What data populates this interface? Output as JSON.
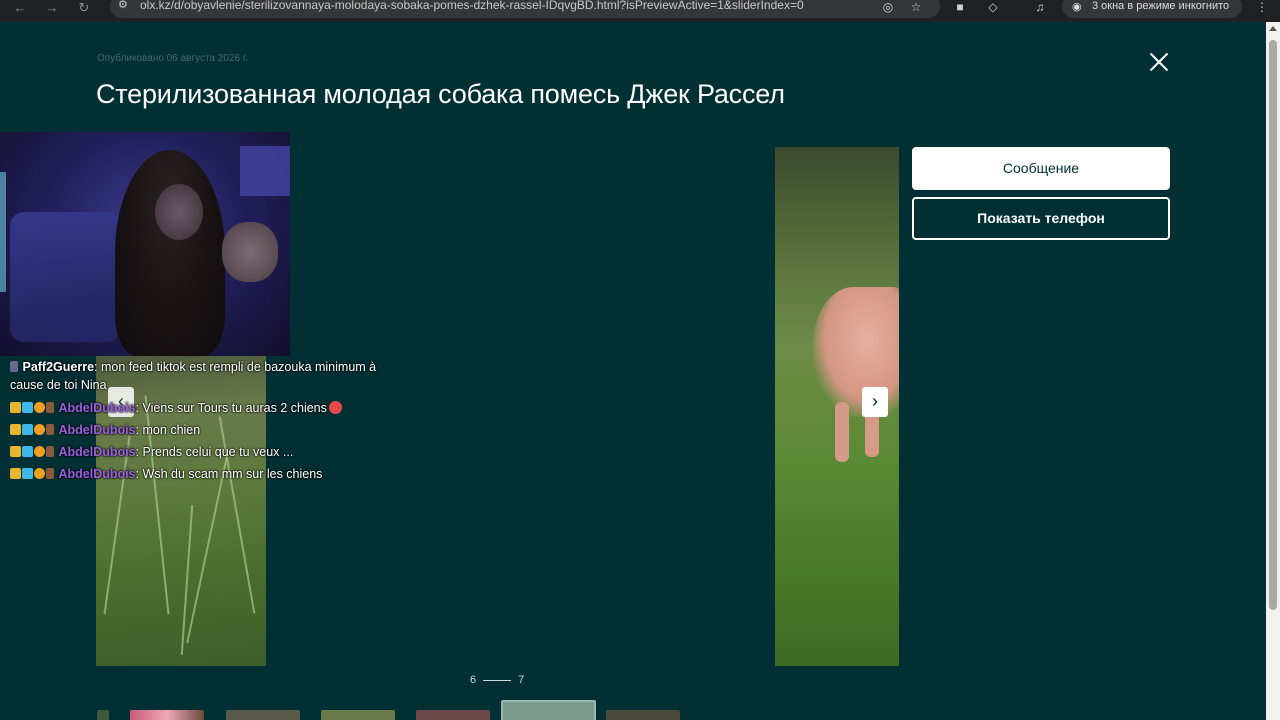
{
  "browser": {
    "url": "olx.kz/d/obyavlenie/sterilizovannaya-molodaya-sobaka-pomes-dzhek-rassel-IDqvgBD.html?isPreviewActive=1&sliderIndex=0",
    "incognito_label": "3 окна в режиме инкогнито"
  },
  "listing": {
    "published": "Опубликовано 06 августа 2026 г.",
    "title": "Стерилизованная молодая собака помесь Джек Рассел"
  },
  "actions": {
    "message_label": "Сообщение",
    "phone_label": "Показать телефон"
  },
  "slider": {
    "prev_arrow": "‹",
    "next_arrow": "›",
    "current_page": "6",
    "total_pages": "7"
  },
  "chat": {
    "messages": [
      {
        "user": "Paff2Guerre",
        "text": ": mon feed tiktok est rempli de bazouka minimum à cause de toi Nina"
      },
      {
        "user": "AbdelDubois",
        "text": ": Viens sur Tours tu auras 2 chiens"
      },
      {
        "user": "AbdelDubois",
        "text": ": mon chien"
      },
      {
        "user": "AbdelDubois",
        "text": ": Prends celui que tu veux ..."
      },
      {
        "user": "AbdelDubois",
        "text": ": Wsh du scam mm sur les chiens"
      }
    ]
  },
  "icons": {
    "close": "close-icon",
    "back": "back-arrow-icon",
    "forward": "forward-arrow-icon",
    "reload": "reload-icon",
    "star": "star-icon",
    "eye_off": "eye-off-icon",
    "incognito": "incognito-icon"
  },
  "colors": {
    "background": "#002f34",
    "button_primary_bg": "#ffffff",
    "chat_username_purple": "#9a5fe0"
  }
}
